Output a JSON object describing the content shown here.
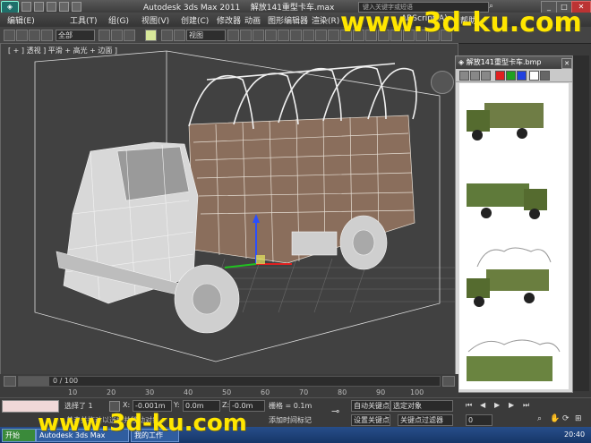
{
  "title_bar": {
    "app_title": "Autodesk 3ds Max  2011",
    "file_name": "解放141重型卡车.max",
    "search_placeholder": "键入关键字或短语"
  },
  "menu": {
    "items": [
      "编辑(E)",
      "工具(T)",
      "组(G)",
      "视图(V)",
      "创建(C)",
      "修改器",
      "动画",
      "图形编辑器",
      "渲染(R)",
      "ARScript(A)",
      "帮助"
    ]
  },
  "toolbar": {
    "selection_filter": "全部",
    "ref_coord": "视图"
  },
  "viewport": {
    "label": "[ + ] 透视 ] 平滑 + 高光 + 边面 ]"
  },
  "image_viewer": {
    "title": "解放141重型卡车.bmp",
    "swatch_colors": [
      "#e02020",
      "#20a020",
      "#2040e0"
    ]
  },
  "timeline": {
    "frame_text": "0 / 100",
    "ticks": [
      "10",
      "20",
      "30",
      "40",
      "50",
      "60",
      "70",
      "80",
      "90",
      "100"
    ]
  },
  "status": {
    "selected": "选择了 1",
    "x_label": "X:",
    "x_value": "-0.001m",
    "y_label": "Y:",
    "y_value": "0.0m",
    "z_label": "Z:",
    "z_value": "-0.0m",
    "grid": "栅格 = 0.1m",
    "add_time_tag": "添加时间标记",
    "auto_key": "自动关键点",
    "selected_objects": "选定对象",
    "set_key": "设置关键点",
    "key_filters": "关键点过滤器",
    "frame_field": "0",
    "prompt": "单击并拖动以选择并移动对象",
    "time_readout": "20:40"
  },
  "taskbar": {
    "items": [
      "开始",
      "Autodesk 3ds Max",
      "我的工作"
    ]
  },
  "watermark": "www.3d-ku.com"
}
